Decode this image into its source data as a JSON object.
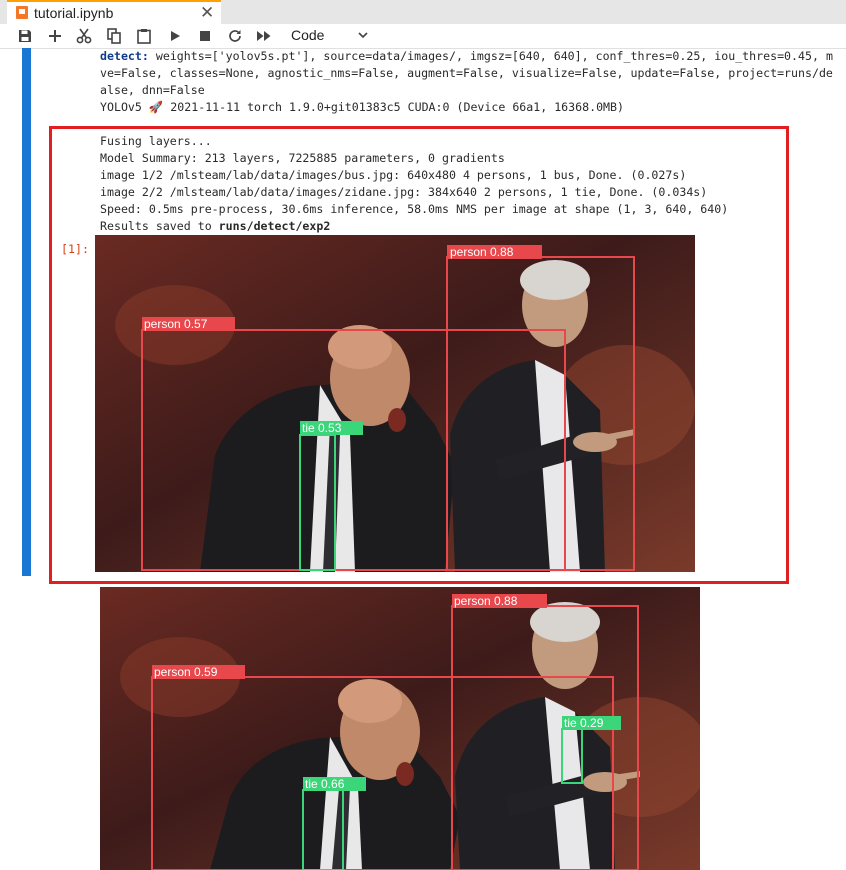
{
  "tab": {
    "title": "tutorial.ipynb"
  },
  "toolbar": {
    "buttons": [
      "save-icon",
      "add-cell-icon",
      "cut-icon",
      "copy-icon",
      "paste-icon",
      "run-icon",
      "stop-icon",
      "restart-icon",
      "fast-forward-icon"
    ],
    "cell_type": "Code"
  },
  "output_top": {
    "l1_kw": "detect:",
    "l1_rest": " weights=['yolov5s.pt'], source=data/images/, imgsz=[640, 640], conf_thres=0.25, iou_thres=0.45, m",
    "l2": "ve=False, classes=None, agnostic_nms=False, augment=False, visualize=False, update=False, project=runs/de",
    "l3": "alse, dnn=False",
    "l4a": "YOLOv5",
    "l4b": "2021-11-11 torch 1.9.0+git01383c5 CUDA:0 (Device 66a1, 16368.0MB)"
  },
  "output_box": {
    "l1": "Fusing layers...",
    "l2": "Model Summary: 213 layers, 7225885 parameters, 0 gradients",
    "l3": "image 1/2 /mlsteam/lab/data/images/bus.jpg: 640x480 4 persons, 1 bus, Done. (0.027s)",
    "l4": "image 2/2 /mlsteam/lab/data/images/zidane.jpg: 384x640 2 persons, 1 tie, Done. (0.034s)",
    "l5": "Speed: 0.5ms pre-process, 30.6ms inference, 58.0ms NMS per image at shape (1, 3, 640, 640)",
    "l6a": "Results saved to ",
    "l6b": "runs/detect/exp2"
  },
  "prompt": "[1]:",
  "image1": {
    "labels": {
      "p1": "person 0.88",
      "p2": "person 0.57",
      "tie": "tie 0.53"
    }
  },
  "image2": {
    "labels": {
      "p1": "person 0.88",
      "p2": "person 0.59",
      "tie1": "tie 0.66",
      "tie2": "tie 0.29"
    }
  },
  "colors": {
    "accent": "#1976d2",
    "highlight": "#e02020",
    "box_person": "#e8474c",
    "box_tie": "#3cd67a"
  }
}
